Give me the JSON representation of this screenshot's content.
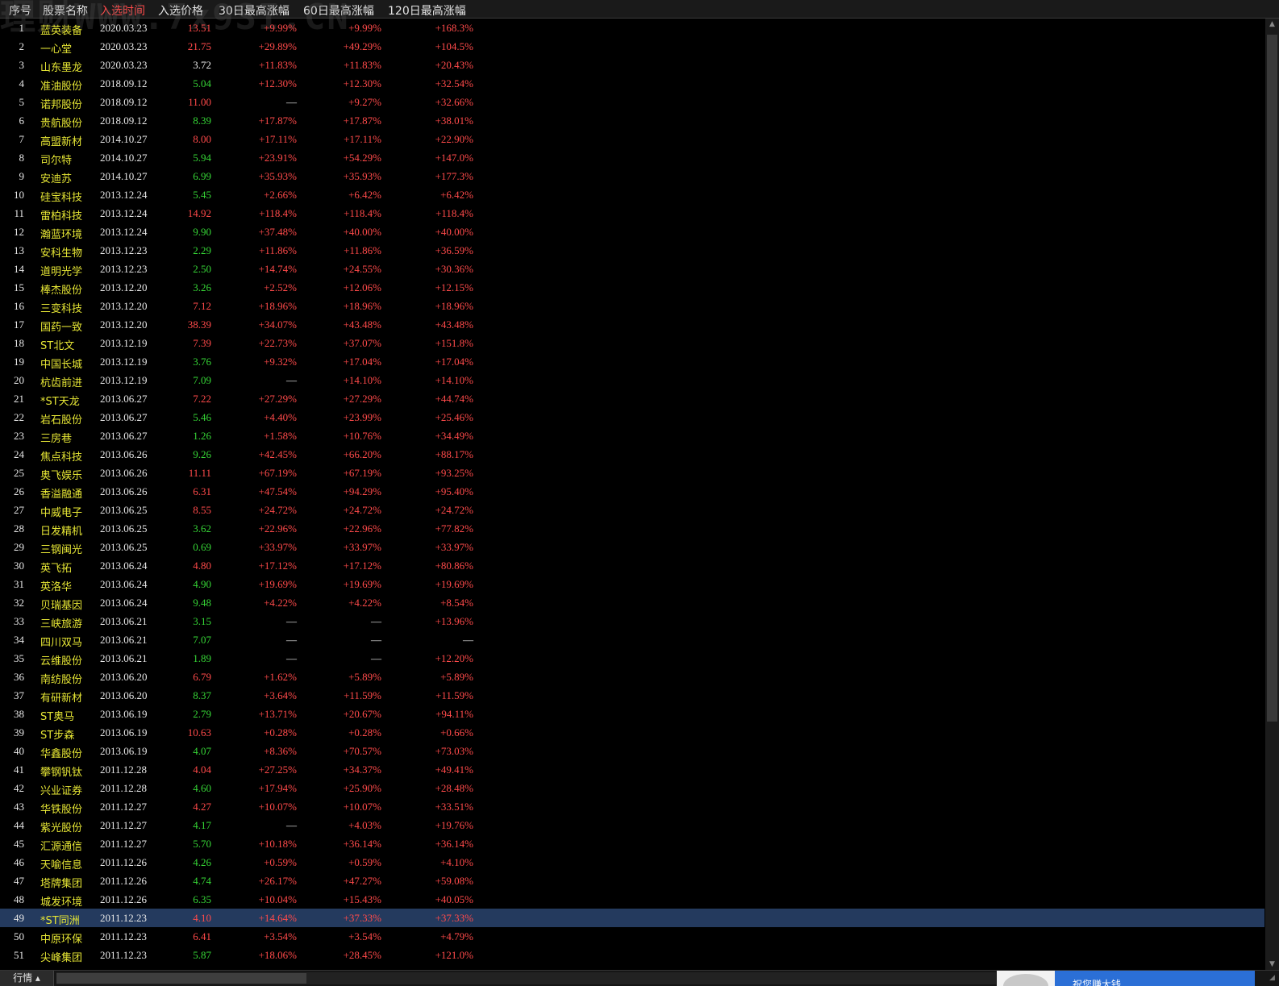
{
  "watermark": "理财WWW.7x9SI.CN",
  "header": {
    "col_idx": "序号",
    "col_name": "股票名称",
    "col_date": "入选时间",
    "col_price": "入选价格",
    "col_30": "30日最高涨幅",
    "col_60": "60日最高涨幅",
    "col_120": "120日最高涨幅",
    "active_color": "#ff4a4a"
  },
  "colors": {
    "up": "#ff4a4a",
    "down": "#36d636",
    "name": "#e6e635",
    "selected_row": "#243a5e"
  },
  "selected_index": 49,
  "rows": [
    {
      "idx": "1",
      "name": "蓝英装备",
      "date": "2020.03.23",
      "price": "13.51",
      "p_dir": "up",
      "r30": "+9.99%",
      "r60": "+9.99%",
      "r120": "+168.3%"
    },
    {
      "idx": "2",
      "name": "一心堂",
      "date": "2020.03.23",
      "price": "21.75",
      "p_dir": "up",
      "r30": "+29.89%",
      "r60": "+49.29%",
      "r120": "+104.5%"
    },
    {
      "idx": "3",
      "name": "山东墨龙",
      "date": "2020.03.23",
      "price": "3.72",
      "p_dir": "flat",
      "r30": "+11.83%",
      "r60": "+11.83%",
      "r120": "+20.43%"
    },
    {
      "idx": "4",
      "name": "准油股份",
      "date": "2018.09.12",
      "price": "5.04",
      "p_dir": "down",
      "r30": "+12.30%",
      "r60": "+12.30%",
      "r120": "+32.54%"
    },
    {
      "idx": "5",
      "name": "诺邦股份",
      "date": "2018.09.12",
      "price": "11.00",
      "p_dir": "up",
      "r30": "—",
      "r60": "+9.27%",
      "r120": "+32.66%"
    },
    {
      "idx": "6",
      "name": "贵航股份",
      "date": "2018.09.12",
      "price": "8.39",
      "p_dir": "down",
      "r30": "+17.87%",
      "r60": "+17.87%",
      "r120": "+38.01%"
    },
    {
      "idx": "7",
      "name": "高盟新材",
      "date": "2014.10.27",
      "price": "8.00",
      "p_dir": "up",
      "r30": "+17.11%",
      "r60": "+17.11%",
      "r120": "+22.90%"
    },
    {
      "idx": "8",
      "name": "司尔特",
      "date": "2014.10.27",
      "price": "5.94",
      "p_dir": "down",
      "r30": "+23.91%",
      "r60": "+54.29%",
      "r120": "+147.0%"
    },
    {
      "idx": "9",
      "name": "安迪苏",
      "date": "2014.10.27",
      "price": "6.99",
      "p_dir": "down",
      "r30": "+35.93%",
      "r60": "+35.93%",
      "r120": "+177.3%"
    },
    {
      "idx": "10",
      "name": "硅宝科技",
      "date": "2013.12.24",
      "price": "5.45",
      "p_dir": "down",
      "r30": "+2.66%",
      "r60": "+6.42%",
      "r120": "+6.42%"
    },
    {
      "idx": "11",
      "name": "雷柏科技",
      "date": "2013.12.24",
      "price": "14.92",
      "p_dir": "up",
      "r30": "+118.4%",
      "r60": "+118.4%",
      "r120": "+118.4%"
    },
    {
      "idx": "12",
      "name": "瀚蓝环境",
      "date": "2013.12.24",
      "price": "9.90",
      "p_dir": "down",
      "r30": "+37.48%",
      "r60": "+40.00%",
      "r120": "+40.00%"
    },
    {
      "idx": "13",
      "name": "安科生物",
      "date": "2013.12.23",
      "price": "2.29",
      "p_dir": "down",
      "r30": "+11.86%",
      "r60": "+11.86%",
      "r120": "+36.59%"
    },
    {
      "idx": "14",
      "name": "道明光学",
      "date": "2013.12.23",
      "price": "2.50",
      "p_dir": "down",
      "r30": "+14.74%",
      "r60": "+24.55%",
      "r120": "+30.36%"
    },
    {
      "idx": "15",
      "name": "棒杰股份",
      "date": "2013.12.20",
      "price": "3.26",
      "p_dir": "down",
      "r30": "+2.52%",
      "r60": "+12.06%",
      "r120": "+12.15%"
    },
    {
      "idx": "16",
      "name": "三变科技",
      "date": "2013.12.20",
      "price": "7.12",
      "p_dir": "up",
      "r30": "+18.96%",
      "r60": "+18.96%",
      "r120": "+18.96%"
    },
    {
      "idx": "17",
      "name": "国药一致",
      "date": "2013.12.20",
      "price": "38.39",
      "p_dir": "up",
      "r30": "+34.07%",
      "r60": "+43.48%",
      "r120": "+43.48%"
    },
    {
      "idx": "18",
      "name": "ST北文",
      "date": "2013.12.19",
      "price": "7.39",
      "p_dir": "up",
      "r30": "+22.73%",
      "r60": "+37.07%",
      "r120": "+151.8%"
    },
    {
      "idx": "19",
      "name": "中国长城",
      "date": "2013.12.19",
      "price": "3.76",
      "p_dir": "down",
      "r30": "+9.32%",
      "r60": "+17.04%",
      "r120": "+17.04%"
    },
    {
      "idx": "20",
      "name": "杭齿前进",
      "date": "2013.12.19",
      "price": "7.09",
      "p_dir": "down",
      "r30": "—",
      "r60": "+14.10%",
      "r120": "+14.10%"
    },
    {
      "idx": "21",
      "name": "*ST天龙",
      "date": "2013.06.27",
      "price": "7.22",
      "p_dir": "up",
      "r30": "+27.29%",
      "r60": "+27.29%",
      "r120": "+44.74%"
    },
    {
      "idx": "22",
      "name": "岩石股份",
      "date": "2013.06.27",
      "price": "5.46",
      "p_dir": "down",
      "r30": "+4.40%",
      "r60": "+23.99%",
      "r120": "+25.46%"
    },
    {
      "idx": "23",
      "name": "三房巷",
      "date": "2013.06.27",
      "price": "1.26",
      "p_dir": "down",
      "r30": "+1.58%",
      "r60": "+10.76%",
      "r120": "+34.49%"
    },
    {
      "idx": "24",
      "name": "焦点科技",
      "date": "2013.06.26",
      "price": "9.26",
      "p_dir": "down",
      "r30": "+42.45%",
      "r60": "+66.20%",
      "r120": "+88.17%"
    },
    {
      "idx": "25",
      "name": "奥飞娱乐",
      "date": "2013.06.26",
      "price": "11.11",
      "p_dir": "up",
      "r30": "+67.19%",
      "r60": "+67.19%",
      "r120": "+93.25%"
    },
    {
      "idx": "26",
      "name": "香溢融通",
      "date": "2013.06.26",
      "price": "6.31",
      "p_dir": "up",
      "r30": "+47.54%",
      "r60": "+94.29%",
      "r120": "+95.40%"
    },
    {
      "idx": "27",
      "name": "中威电子",
      "date": "2013.06.25",
      "price": "8.55",
      "p_dir": "up",
      "r30": "+24.72%",
      "r60": "+24.72%",
      "r120": "+24.72%"
    },
    {
      "idx": "28",
      "name": "日发精机",
      "date": "2013.06.25",
      "price": "3.62",
      "p_dir": "down",
      "r30": "+22.96%",
      "r60": "+22.96%",
      "r120": "+77.82%"
    },
    {
      "idx": "29",
      "name": "三钢闽光",
      "date": "2013.06.25",
      "price": "0.69",
      "p_dir": "down",
      "r30": "+33.97%",
      "r60": "+33.97%",
      "r120": "+33.97%"
    },
    {
      "idx": "30",
      "name": "英飞拓",
      "date": "2013.06.24",
      "price": "4.80",
      "p_dir": "up",
      "r30": "+17.12%",
      "r60": "+17.12%",
      "r120": "+80.86%"
    },
    {
      "idx": "31",
      "name": "英洛华",
      "date": "2013.06.24",
      "price": "4.90",
      "p_dir": "down",
      "r30": "+19.69%",
      "r60": "+19.69%",
      "r120": "+19.69%"
    },
    {
      "idx": "32",
      "name": "贝瑞基因",
      "date": "2013.06.24",
      "price": "9.48",
      "p_dir": "down",
      "r30": "+4.22%",
      "r60": "+4.22%",
      "r120": "+8.54%"
    },
    {
      "idx": "33",
      "name": "三峡旅游",
      "date": "2013.06.21",
      "price": "3.15",
      "p_dir": "down",
      "r30": "—",
      "r60": "—",
      "r120": "+13.96%"
    },
    {
      "idx": "34",
      "name": "四川双马",
      "date": "2013.06.21",
      "price": "7.07",
      "p_dir": "down",
      "r30": "—",
      "r60": "—",
      "r120": "—"
    },
    {
      "idx": "35",
      "name": "云维股份",
      "date": "2013.06.21",
      "price": "1.89",
      "p_dir": "down",
      "r30": "—",
      "r60": "—",
      "r120": "+12.20%"
    },
    {
      "idx": "36",
      "name": "南纺股份",
      "date": "2013.06.20",
      "price": "6.79",
      "p_dir": "up",
      "r30": "+1.62%",
      "r60": "+5.89%",
      "r120": "+5.89%"
    },
    {
      "idx": "37",
      "name": "有研新材",
      "date": "2013.06.20",
      "price": "8.37",
      "p_dir": "down",
      "r30": "+3.64%",
      "r60": "+11.59%",
      "r120": "+11.59%"
    },
    {
      "idx": "38",
      "name": "ST奥马",
      "date": "2013.06.19",
      "price": "2.79",
      "p_dir": "down",
      "r30": "+13.71%",
      "r60": "+20.67%",
      "r120": "+94.11%"
    },
    {
      "idx": "39",
      "name": "ST步森",
      "date": "2013.06.19",
      "price": "10.63",
      "p_dir": "up",
      "r30": "+0.28%",
      "r60": "+0.28%",
      "r120": "+0.66%"
    },
    {
      "idx": "40",
      "name": "华鑫股份",
      "date": "2013.06.19",
      "price": "4.07",
      "p_dir": "down",
      "r30": "+8.36%",
      "r60": "+70.57%",
      "r120": "+73.03%"
    },
    {
      "idx": "41",
      "name": "攀钢钒钛",
      "date": "2011.12.28",
      "price": "4.04",
      "p_dir": "up",
      "r30": "+27.25%",
      "r60": "+34.37%",
      "r120": "+49.41%"
    },
    {
      "idx": "42",
      "name": "兴业证券",
      "date": "2011.12.28",
      "price": "4.60",
      "p_dir": "down",
      "r30": "+17.94%",
      "r60": "+25.90%",
      "r120": "+28.48%"
    },
    {
      "idx": "43",
      "name": "华铁股份",
      "date": "2011.12.27",
      "price": "4.27",
      "p_dir": "up",
      "r30": "+10.07%",
      "r60": "+10.07%",
      "r120": "+33.51%"
    },
    {
      "idx": "44",
      "name": "紫光股份",
      "date": "2011.12.27",
      "price": "4.17",
      "p_dir": "down",
      "r30": "—",
      "r60": "+4.03%",
      "r120": "+19.76%"
    },
    {
      "idx": "45",
      "name": "汇源通信",
      "date": "2011.12.27",
      "price": "5.70",
      "p_dir": "down",
      "r30": "+10.18%",
      "r60": "+36.14%",
      "r120": "+36.14%"
    },
    {
      "idx": "46",
      "name": "天喻信息",
      "date": "2011.12.26",
      "price": "4.26",
      "p_dir": "down",
      "r30": "+0.59%",
      "r60": "+0.59%",
      "r120": "+4.10%"
    },
    {
      "idx": "47",
      "name": "塔牌集团",
      "date": "2011.12.26",
      "price": "4.74",
      "p_dir": "down",
      "r30": "+26.17%",
      "r60": "+47.27%",
      "r120": "+59.08%"
    },
    {
      "idx": "48",
      "name": "城发环境",
      "date": "2011.12.26",
      "price": "6.35",
      "p_dir": "down",
      "r30": "+10.04%",
      "r60": "+15.43%",
      "r120": "+40.05%"
    },
    {
      "idx": "49",
      "name": "*ST同洲",
      "date": "2011.12.23",
      "price": "4.10",
      "p_dir": "up",
      "r30": "+14.64%",
      "r60": "+37.33%",
      "r120": "+37.33%"
    },
    {
      "idx": "50",
      "name": "中原环保",
      "date": "2011.12.23",
      "price": "6.41",
      "p_dir": "up",
      "r30": "+3.54%",
      "r60": "+3.54%",
      "r120": "+4.79%"
    },
    {
      "idx": "51",
      "name": "尖峰集团",
      "date": "2011.12.23",
      "price": "5.87",
      "p_dir": "down",
      "r30": "+18.06%",
      "r60": "+28.45%",
      "r120": "+121.0%"
    }
  ],
  "bottom": {
    "tab_label": "行情 ▴",
    "ad_text": "祝您赚大钱"
  },
  "icons": {
    "scroll_up": "▲",
    "scroll_down": "▼",
    "corner": "◢"
  }
}
